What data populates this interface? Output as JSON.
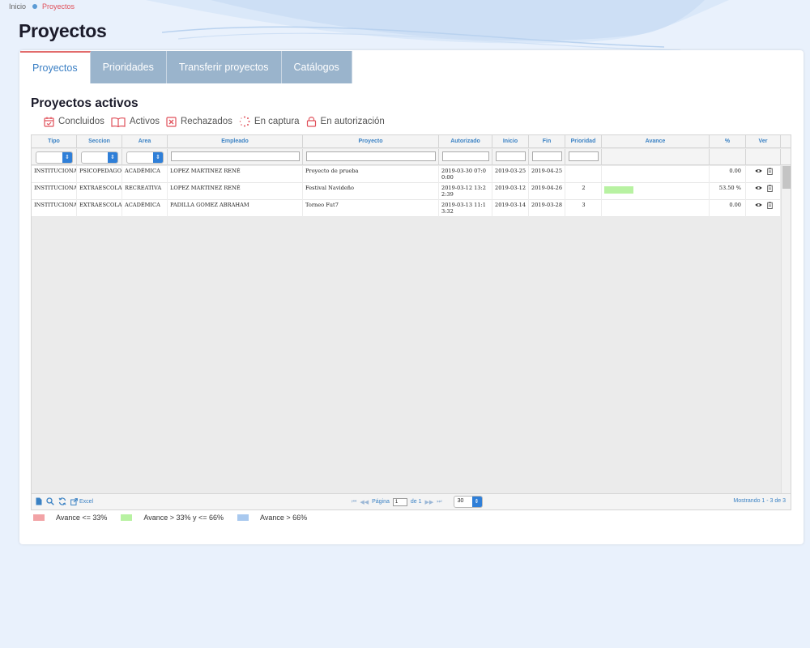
{
  "breadcrumb": {
    "home": "Inicio",
    "current": "Proyectos"
  },
  "page_title": "Proyectos",
  "tabs": [
    {
      "label": "Proyectos",
      "active": true
    },
    {
      "label": "Prioridades",
      "active": false
    },
    {
      "label": "Transferir proyectos",
      "active": false
    },
    {
      "label": "Catálogos",
      "active": false
    }
  ],
  "section_title": "Proyectos activos",
  "status_legend": [
    {
      "label": "Concluidos",
      "icon": "calendar-check-icon"
    },
    {
      "label": "Activos",
      "icon": "open-book-icon"
    },
    {
      "label": "Rechazados",
      "icon": "x-box-icon"
    },
    {
      "label": "En captura",
      "icon": "spinner-icon"
    },
    {
      "label": "En autorización",
      "icon": "lock-icon"
    }
  ],
  "grid": {
    "columns": [
      "Tipo",
      "Seccion",
      "Area",
      "Empleado",
      "Proyecto",
      "Autorizado",
      "Inicio",
      "Fin",
      "Prioridad",
      "Avance",
      "%",
      "Ver"
    ],
    "rows": [
      {
        "tipo": "INSTITUCIONAL",
        "seccion": "PSICOPEDAGOGICO",
        "area": "ACADÉMICA",
        "empleado": "LOPEZ MARTINEZ RENÉ",
        "proyecto": "Proyecto de prueba",
        "autorizado": "2019-03-30 07:00:00",
        "inicio": "2019-03-25",
        "fin": "2019-04-25",
        "prioridad": "",
        "avance": 0.0,
        "porcentaje": "0.00"
      },
      {
        "tipo": "INSTITUCIONAL",
        "seccion": "EXTRAESCOLAR",
        "area": "RECREATIVA",
        "empleado": "LOPEZ MARTINEZ RENÉ",
        "proyecto": "Festival Navideño",
        "autorizado": "2019-03-12 13:22:39",
        "inicio": "2019-03-12",
        "fin": "2019-04-26",
        "prioridad": "2",
        "avance": 53.5,
        "porcentaje": "53.50 %"
      },
      {
        "tipo": "INSTITUCIONAL",
        "seccion": "EXTRAESCOLAR",
        "area": "ACADÉMICA",
        "empleado": "PADILLA GOMEZ ABRAHAM",
        "proyecto": "Torneo Fut7",
        "autorizado": "2019-03-13 11:13:32",
        "inicio": "2019-03-14",
        "fin": "2019-03-28",
        "prioridad": "3",
        "avance": 0.0,
        "porcentaje": "0.00"
      }
    ]
  },
  "pager": {
    "excel_label": "Excel",
    "page_label": "Página",
    "page_value": "1",
    "of_label": "de 1",
    "page_size": "30",
    "summary": "Mostrando 1 - 3 de 3"
  },
  "avance_legend": [
    {
      "label": "Avance <= 33%",
      "color": "#f2a3a6"
    },
    {
      "label": "Avance > 33% y <= 66%",
      "color": "#b8f2a2"
    },
    {
      "label": "Avance > 66%",
      "color": "#a9c9ef"
    }
  ],
  "colors": {
    "accent": "#3b82c4",
    "tab_inactive": "#9ab4cc",
    "status_icon": "#e0505a"
  }
}
